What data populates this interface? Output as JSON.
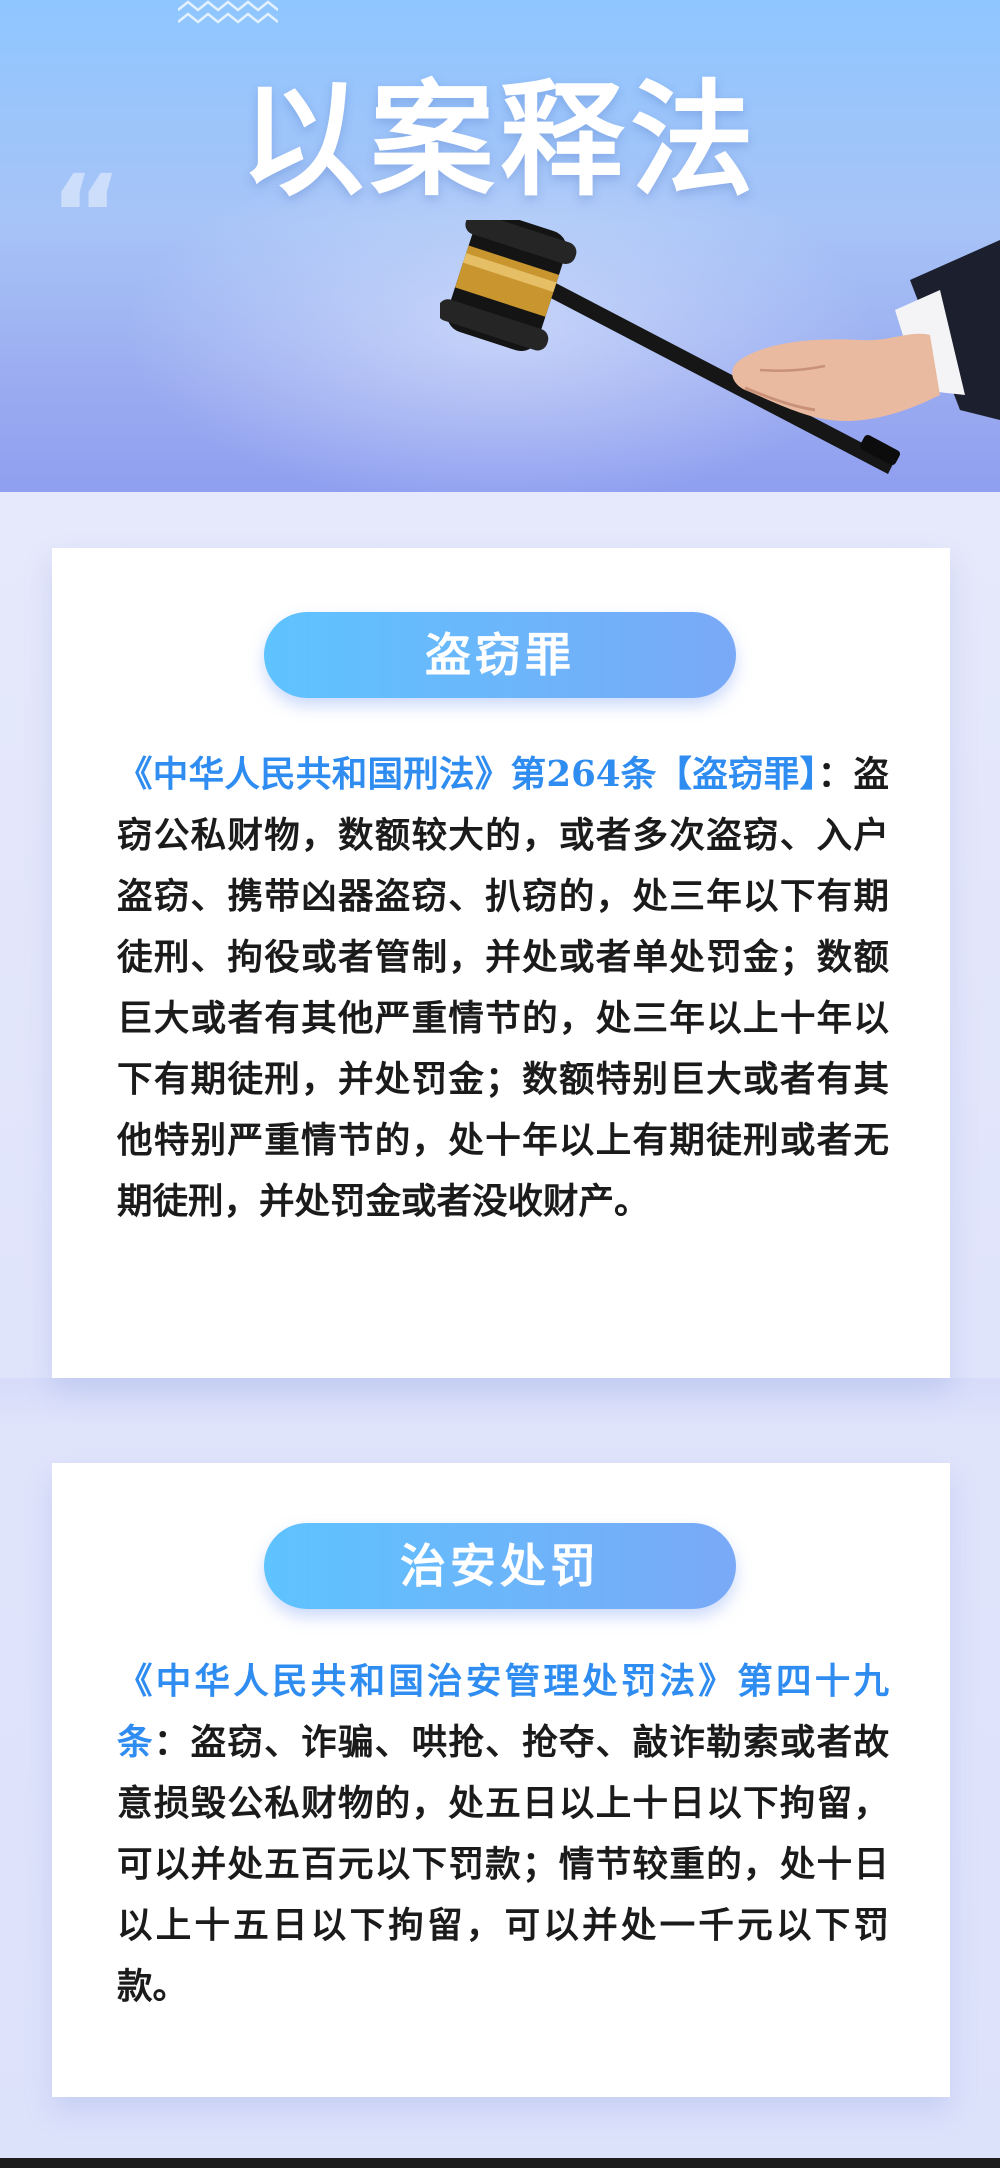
{
  "hero": {
    "title": "以案释法",
    "quote_icon": "quote-mark-icon",
    "illustration_icon": "gavel-in-hand-icon",
    "decor_icon": "zigzag-icon"
  },
  "sections": [
    {
      "heading": "盗窃罪",
      "reference": "《中华人民共和国刑法》第264条【盗窃罪】",
      "text": "：盗窃公私财物，数额较大的，或者多次盗窃、入户盗窃、携带凶器盗窃、扒窃的，处三年以下有期徒刑、拘役或者管制，并处或者单处罚金；数额巨大或者有其他严重情节的，处三年以上十年以下有期徒刑，并处罚金；数额特别巨大或者有其他特别严重情节的，处十年以上有期徒刑或者无期徒刑，并处罚金或者没收财产。"
    },
    {
      "heading": "治安处罚",
      "reference": "《中华人民共和国治安管理处罚法》第四十九条",
      "text": "：盗窃、诈骗、哄抢、抢夺、敲诈勒索或者故意损毁公私财物的，处五日以上十日以下拘留，可以并处五百元以下罚款；情节较重的，处十日以上十五日以下拘留，可以并处一千元以下罚款。"
    }
  ],
  "colors": {
    "accent_blue": "#2f8cf0",
    "pill_start": "#5ec3ff",
    "pill_end": "#79a9f7",
    "body_text": "#1b1b1b"
  }
}
